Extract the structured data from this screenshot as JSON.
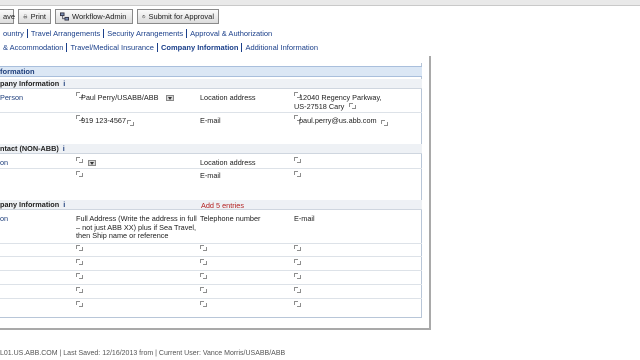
{
  "toolbar": {
    "save_label": "ave",
    "print_label": "Print",
    "workflow_label": "Workflow-Admin",
    "submit_label": "Submit for Approval"
  },
  "tabs_row1": [
    "ountry",
    "Travel Arrangements",
    "Security Arrangements",
    "Approval & Authorization"
  ],
  "tabs_row2": [
    "& Accommodation",
    "Travel/Medical Insurance",
    "Company Information",
    "Additional Information"
  ],
  "active_tab": "Company Information",
  "section_title": "formation",
  "company_info": {
    "title": "pany Information",
    "info_glyph": "i",
    "person_label": "Person",
    "person_value": "Paul Perry/USABB/ABB",
    "location_label": "Location address",
    "location_value_1": "12040 Regency Parkway,",
    "location_value_2": "US-27518 Cary",
    "phone_value": "919 123-4567",
    "email_label": "E-mail",
    "email_value": "paul.perry@us.abb.com"
  },
  "contact_non_abb": {
    "title": "ntact (NON-ABB)",
    "info_glyph": "i",
    "person_label": "on",
    "location_label": "Location address",
    "email_label": "E-mail"
  },
  "company_info_2": {
    "title": "pany Information",
    "info_glyph": "i",
    "add_entries": "Add 5 entries",
    "col_person": "on",
    "col_address": "Full Address (Write the address in full – not just ABB XX) plus if Sea Travel, then Ship name or reference",
    "col_phone": "Telephone number",
    "col_email": "E-mail"
  },
  "status_bar": "L01.US.ABB.COM | Last Saved: 12/16/2013 from  | Current User: Vance Morris/USABB/ABB"
}
